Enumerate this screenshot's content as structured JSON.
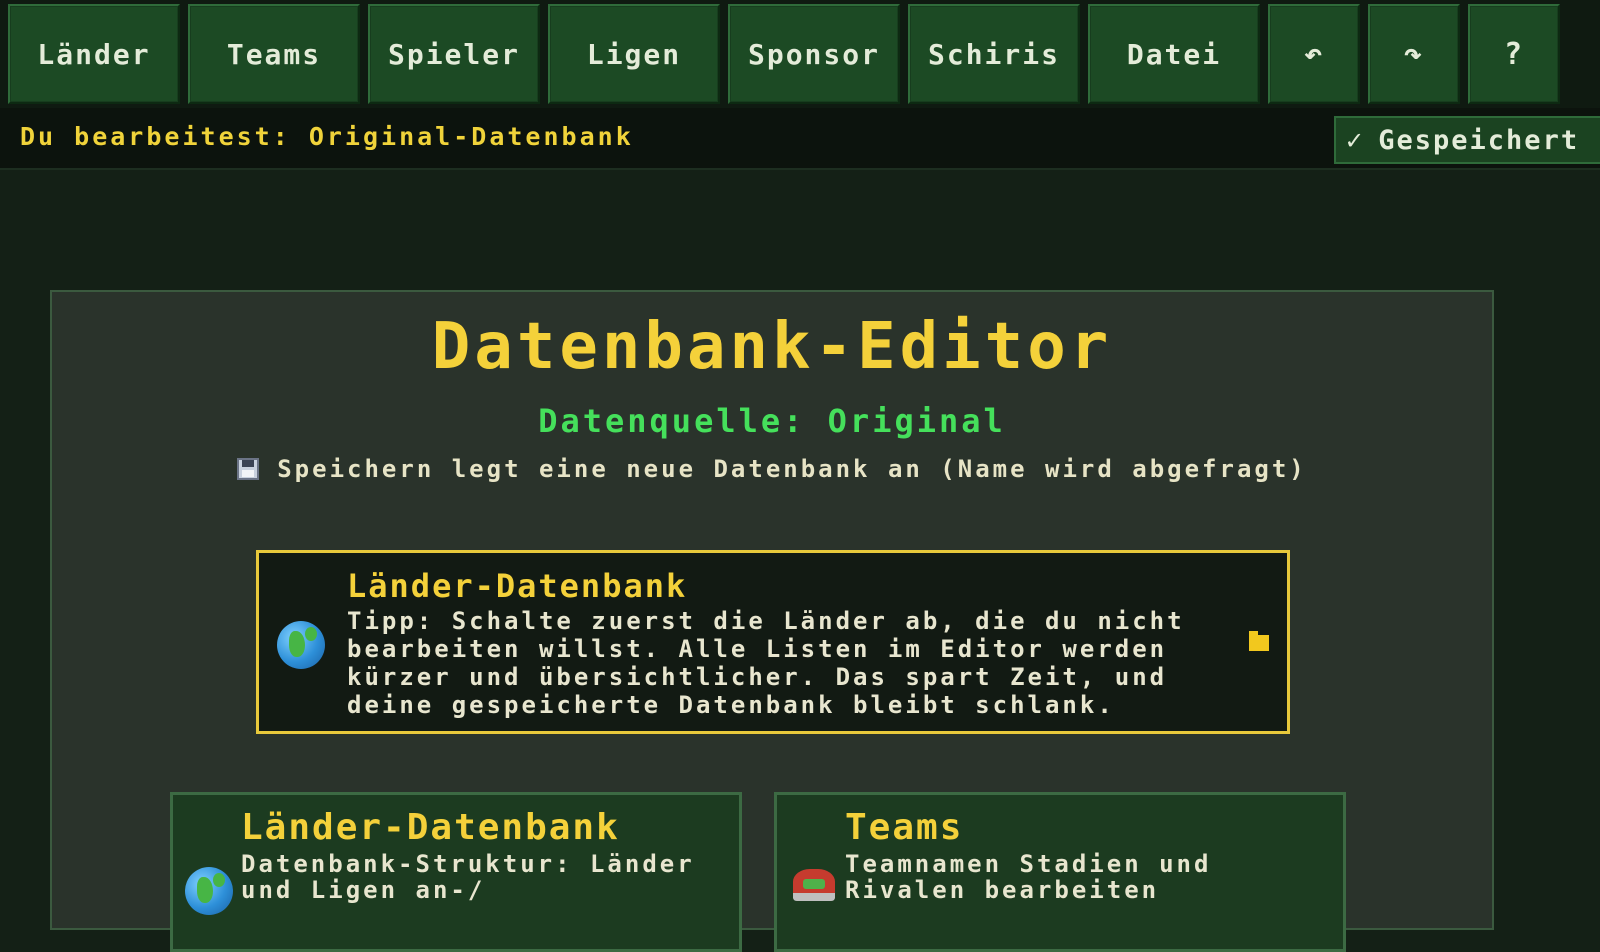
{
  "nav": {
    "items": [
      {
        "label": "Länder"
      },
      {
        "label": "Teams"
      },
      {
        "label": "Spieler"
      },
      {
        "label": "Ligen"
      },
      {
        "label": "Sponsor"
      },
      {
        "label": "Schiris"
      },
      {
        "label": "Datei"
      }
    ],
    "undo_icon": "↶",
    "redo_icon": "↷",
    "help_icon": "?"
  },
  "status": {
    "editing": "Du bearbeitest: Original-Datenbank",
    "saved_check": "✓",
    "saved_label": "Gespeichert"
  },
  "main": {
    "title": "Datenbank-Editor",
    "source": "Datenquelle: Original",
    "save_hint": "Speichern legt eine neue Datenbank an (Name wird abgefragt)",
    "tip": {
      "title": "Länder-Datenbank",
      "body": "Tipp: Schalte zuerst die Länder ab, die du nicht bearbeiten willst. Alle Listen im Editor werden kürzer und übersichtlicher. Das spart Zeit, und deine gespeicherte Datenbank bleibt schlank."
    },
    "cards": [
      {
        "title": "Länder-Datenbank",
        "body": "Datenbank-Struktur: Länder und Ligen an-/",
        "icon": "globe-icon"
      },
      {
        "title": "Teams",
        "body": "Teamnamen Stadien und Rivalen bearbeiten",
        "icon": "stadium-icon"
      }
    ]
  },
  "colors": {
    "accent_yellow": "#f4d13a",
    "source_green": "#45e05b",
    "nav_green": "#1c4a24",
    "background": "#142016"
  }
}
